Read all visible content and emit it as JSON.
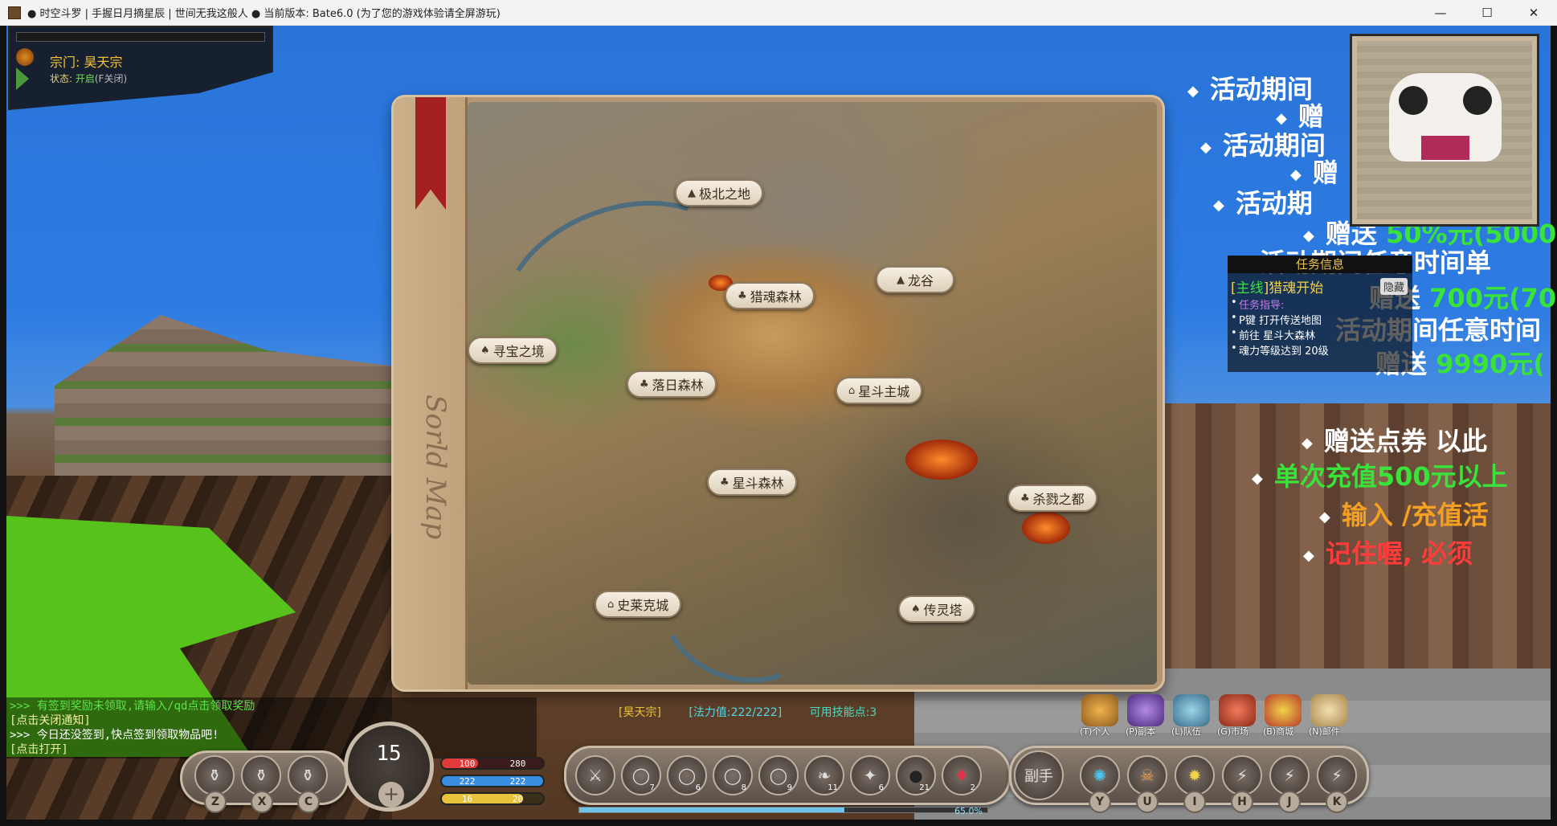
{
  "window": {
    "title": "● 时空斗罗 | 手握日月摘星辰 | 世间无我这般人 ● 当前版本: Bate6.0 (为了您的游戏体验请全屏游玩)",
    "min": "—",
    "max": "☐",
    "close": "✕"
  },
  "sect": {
    "label": "宗门: 昊天宗",
    "status_label": "状态: ",
    "status_value": "开启",
    "status_hint": "(F关闭)"
  },
  "map": {
    "spine_title": "Sorld Map",
    "locations": {
      "north": "极北之地",
      "dragon_valley": "龙谷",
      "soul_forest": "猎魂森林",
      "treasure": "寻宝之境",
      "sunset_forest": "落日森林",
      "main_city": "星斗主城",
      "star_forest": "星斗森林",
      "slaughter": "杀戮之都",
      "shrek": "史莱克城",
      "spirit_tower": "传灵塔"
    }
  },
  "promo": {
    "p1": "活动期间",
    "p2": "赠",
    "p3": "活动期间",
    "p4": "赠",
    "p5": "活动期",
    "p6": "赠送",
    "p6b": "50%元(5000",
    "p7": "活动期间任意时间单",
    "p8": "赠送",
    "p8b": "700元(70",
    "p9": "活动期间任意时间",
    "p10": "赠送",
    "p10b": "9990元(",
    "p11": "赠送点券 以此",
    "p12": "单次充值500元以上",
    "p13": "输入 /充值活",
    "p14": "记住喔, 必须",
    "colors": {
      "white": "#ffffff",
      "green": "#39e33a",
      "orange": "#f5a023",
      "red": "#ff3b3b"
    }
  },
  "quest": {
    "header": "任务信息",
    "main_prefix": "[",
    "main_type": "主线",
    "main_title": "]猎魂开始",
    "hide": "隐藏",
    "guide": "任务指导:",
    "step1": "P键 打开传送地图",
    "step2": "前往 星斗大森林",
    "step3": "魂力等级达到 20级"
  },
  "chat": {
    "line1": ">>> 有签到奖励未领取,请输入/qd点击领取奖励",
    "line2": "[点击关闭通知]",
    "line3": ">>> 今日还没签到,快点签到领取物品吧!",
    "line4": "[点击打开]"
  },
  "status_line": {
    "sect": "[昊天宗]",
    "mana": "[法力值:222/222]",
    "skill_points": "可用技能点:3"
  },
  "hud": {
    "level": "15",
    "plus": "+",
    "hp": {
      "cur": "100",
      "max": "280",
      "pct": 0.36,
      "color": "#e03a3a"
    },
    "mp": {
      "cur": "222",
      "max": "222",
      "pct": 1.0,
      "color": "#3a8ee0"
    },
    "sp": {
      "cur": "16",
      "max": "20",
      "pct": 0.8,
      "color": "#e8c23a"
    },
    "exp_pct": 0.65,
    "exp_label": "65.0%",
    "potion_keys": [
      "Z",
      "X",
      "C"
    ],
    "hotbar_counts": [
      "",
      "7",
      "6",
      "8",
      "9",
      "11",
      "6",
      "21",
      "2"
    ],
    "hand_label": "副手",
    "skill_keys": [
      "Y",
      "U",
      "I",
      "H",
      "J",
      "K"
    ]
  },
  "menu": {
    "personal": "(T)个人",
    "dungeon": "(P)副本",
    "team": "(L)队伍",
    "market": "(G)市场",
    "shop": "(B)商城",
    "mail": "(N)邮件"
  }
}
